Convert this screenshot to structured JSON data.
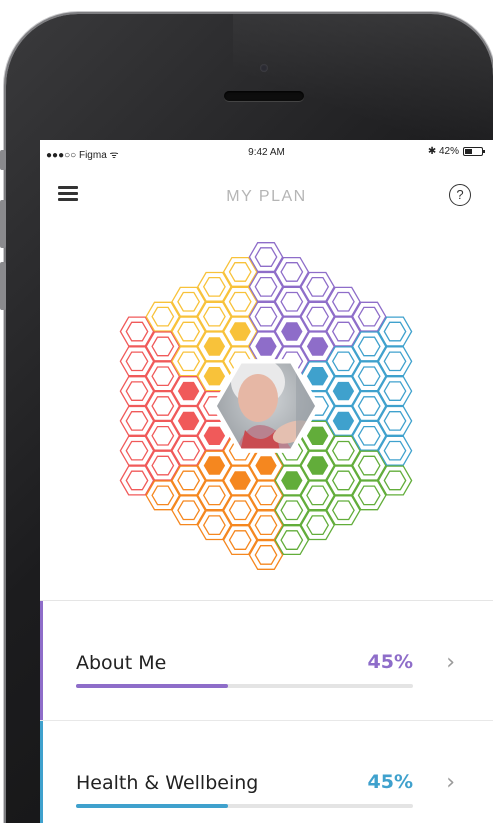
{
  "status_bar": {
    "carrier": "●●●○○ Figma ᯤ",
    "time": "9:42 AM",
    "battery_text": "✱ 42%",
    "battery_level": 0.42
  },
  "nav": {
    "title": "MY PLAN",
    "help_label": "?"
  },
  "hex_wheel": {
    "center_photo": "elderly-woman-portrait",
    "segments": [
      {
        "name": "yellow",
        "color": "#f8c23a"
      },
      {
        "name": "purple",
        "color": "#8e6dc9"
      },
      {
        "name": "blue",
        "color": "#3fa1cd"
      },
      {
        "name": "green",
        "color": "#62ad3a"
      },
      {
        "name": "orange",
        "color": "#f5871f"
      },
      {
        "name": "red",
        "color": "#f05a5a"
      }
    ]
  },
  "plan_items": [
    {
      "label": "About Me",
      "percent_text": "45%",
      "progress": 0.45,
      "color": "#8e6dc9",
      "chevron": "›"
    },
    {
      "label": "Health & Wellbeing",
      "percent_text": "45%",
      "progress": 0.45,
      "color": "#3fa1cd",
      "chevron": "›"
    }
  ]
}
